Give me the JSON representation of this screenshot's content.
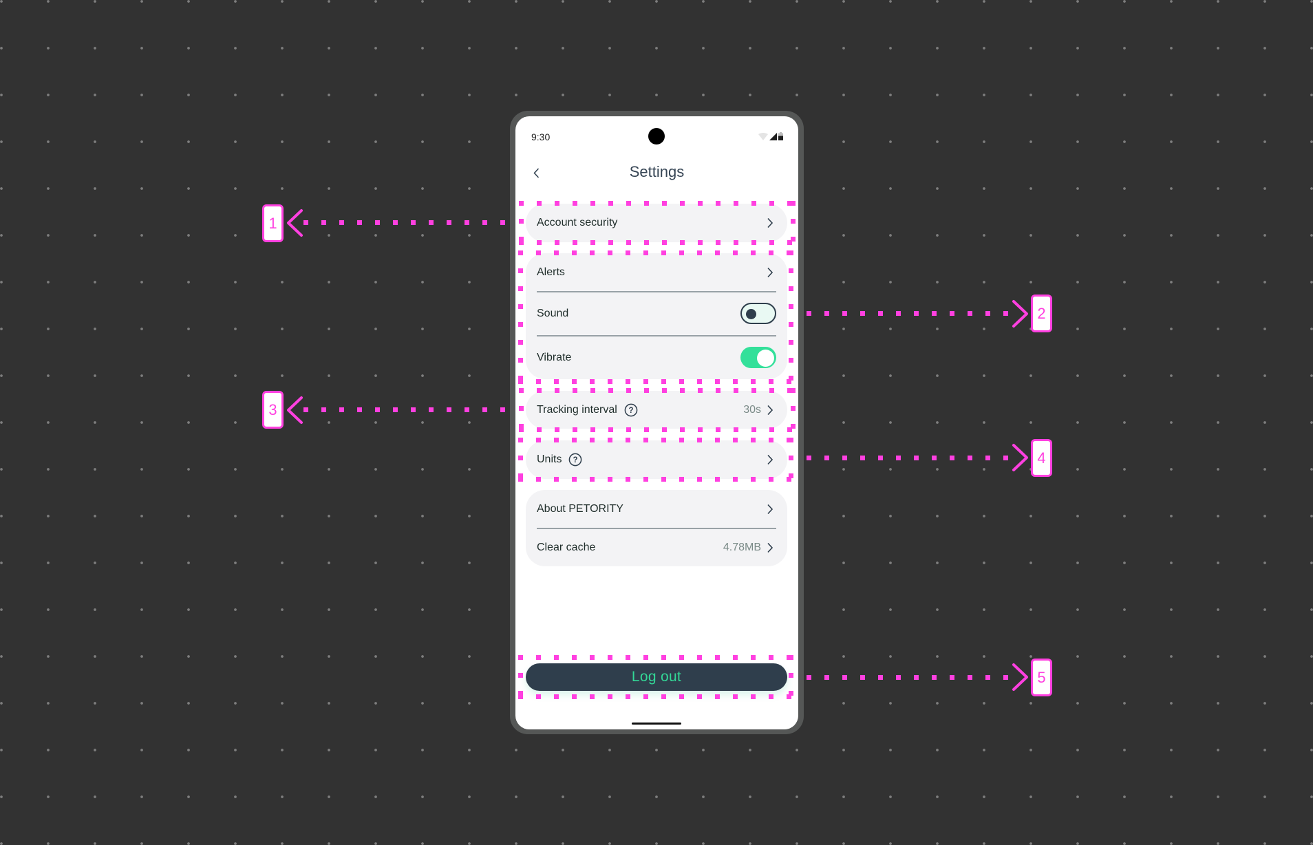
{
  "status_bar": {
    "time": "9:30",
    "icons": [
      "wifi-icon",
      "signal-icon",
      "battery-icon"
    ]
  },
  "header": {
    "back_icon": "chevron-left-icon",
    "title": "Settings"
  },
  "settings": {
    "account_security": {
      "label": "Account security"
    },
    "notifications": {
      "alerts": {
        "label": "Alerts"
      },
      "sound": {
        "label": "Sound",
        "enabled": false
      },
      "vibrate": {
        "label": "Vibrate",
        "enabled": true
      }
    },
    "tracking_interval": {
      "label": "Tracking interval",
      "value": "30s",
      "help_icon": "question-circle-icon"
    },
    "units": {
      "label": "Units",
      "help_icon": "question-circle-icon"
    },
    "about": {
      "label": "About PETORITY"
    },
    "clear_cache": {
      "label": "Clear cache",
      "value": "4.78MB"
    }
  },
  "logout": {
    "label": "Log out"
  },
  "annotations": [
    {
      "number": "1",
      "target": "Account security"
    },
    {
      "number": "2",
      "target": "Alerts / Sound / Vibrate"
    },
    {
      "number": "3",
      "target": "Tracking interval"
    },
    {
      "number": "4",
      "target": "Units"
    },
    {
      "number": "5",
      "target": "Log out"
    }
  ],
  "colors": {
    "background": "#323232",
    "highlight": "#ff40e0",
    "card": "#f3f3f5",
    "primary_dark": "#2f3e4c",
    "accent_green": "#33e09a",
    "logout_text": "#33d897"
  }
}
